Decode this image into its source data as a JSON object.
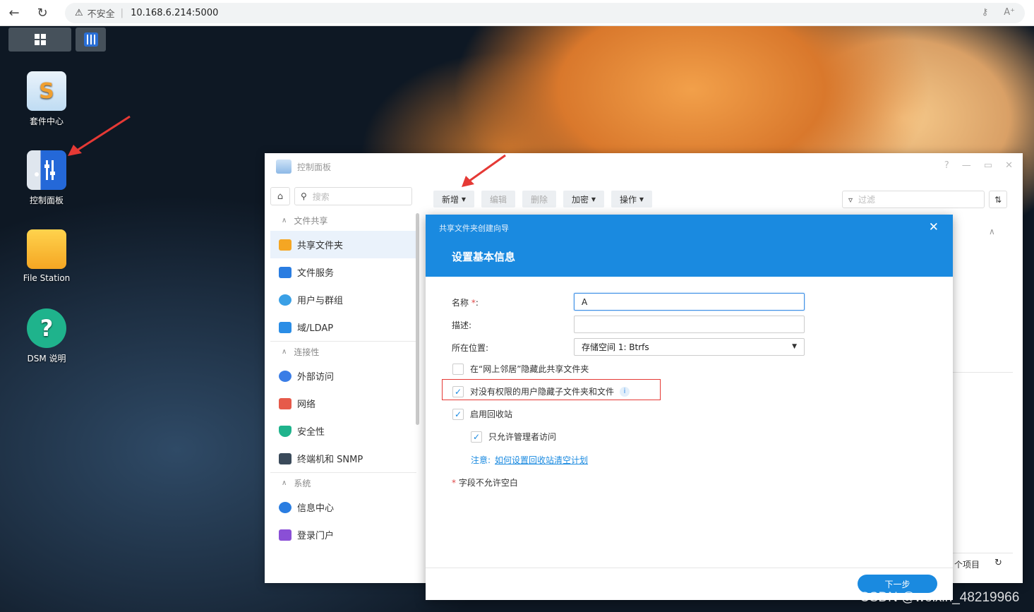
{
  "browser": {
    "security_label": "不安全",
    "url": "10.168.6.214:5000"
  },
  "desktop": {
    "icons": [
      {
        "label": "套件中心"
      },
      {
        "label": "控制面板"
      },
      {
        "label": "File Station"
      },
      {
        "label": "DSM 说明"
      }
    ]
  },
  "control_panel": {
    "title": "控制面板",
    "search_placeholder": "搜索",
    "groups": [
      {
        "label": "文件共享",
        "items": [
          "共享文件夹",
          "文件服务",
          "用户与群组",
          "域/LDAP"
        ]
      },
      {
        "label": "连接性",
        "items": [
          "外部访问",
          "网络",
          "安全性",
          "终端机和 SNMP"
        ]
      },
      {
        "label": "系统",
        "items": [
          "信息中心",
          "登录门户"
        ]
      }
    ],
    "toolbar": {
      "create": "新增",
      "edit": "编辑",
      "delete": "删除",
      "encrypt": "加密",
      "action": "操作"
    },
    "filter_placeholder": "过滤",
    "item_count_label": "个项目"
  },
  "wizard": {
    "subtitle": "共享文件夹创建向导",
    "title": "设置基本信息",
    "name_label": "名称",
    "name_required": "*",
    "name_colon": ":",
    "name_value": "A",
    "desc_label": "描述:",
    "desc_value": "",
    "location_label": "所在位置:",
    "location_value": "存储空间 1:  Btrfs",
    "cb_hide_network": {
      "label": "在“网上邻居”隐藏此共享文件夹",
      "checked": false
    },
    "cb_hide_noperm": {
      "label": "对没有权限的用户隐藏子文件夹和文件",
      "checked": true
    },
    "cb_recycle": {
      "label": "启用回收站",
      "checked": true
    },
    "cb_admin_only": {
      "label": "只允许管理者访问",
      "checked": true
    },
    "note_label": "注意:",
    "note_link": "如何设置回收站清空计划",
    "required_note_star": "*",
    "required_note": "字段不允许空白",
    "next_button": "下一步"
  },
  "watermark": "CSDN @weixin_48219966",
  "colors": {
    "accent": "#1a8ae0",
    "highlight_box": "#e53935",
    "annotation_arrow": "#e53935"
  }
}
